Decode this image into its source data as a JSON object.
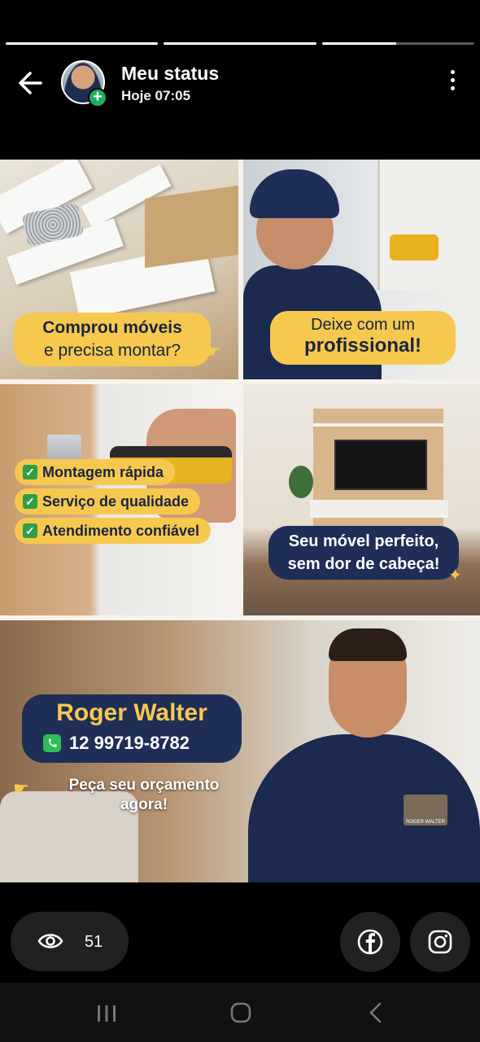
{
  "header": {
    "title": "Meu status",
    "time": "Hoje 07:05"
  },
  "progress": {
    "segments": [
      1.0,
      1.0,
      0.49
    ]
  },
  "story": {
    "panel1_caption_line1": "Comprou móveis",
    "panel1_caption_line2": "e precisa montar?",
    "panel2_caption_line1": "Deixe com um",
    "panel2_caption_line2": "profissional!",
    "checklist": [
      "Montagem rápida",
      "Serviço de qualidade",
      "Atendimento confiável"
    ],
    "panel4_caption_line1": "Seu móvel perfeito,",
    "panel4_caption_line2": "sem dor de cabeça!",
    "name": "Roger Walter",
    "phone": "12 99719-8782",
    "cta_line1": "Peça seu orçamento",
    "cta_line2": "agora!",
    "badge_text": "ROGER WALTER"
  },
  "footer": {
    "views": "51"
  },
  "colors": {
    "accent_yellow": "#f6c94e",
    "navy": "#1f2e57",
    "whatsapp_green": "#2fbd5a",
    "add_green": "#1fae5b"
  },
  "icons": [
    "back-arrow-icon",
    "more-vertical-icon",
    "eye-icon",
    "facebook-icon",
    "instagram-icon",
    "whatsapp-icon",
    "pointing-hand-icon",
    "check-icon",
    "recent-apps-icon",
    "home-icon",
    "nav-back-icon"
  ]
}
